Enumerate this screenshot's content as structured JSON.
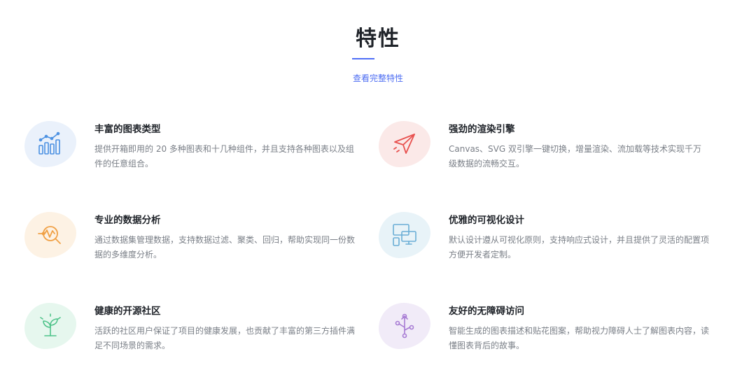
{
  "header": {
    "title": "特性",
    "link": "查看完整特性"
  },
  "features": [
    {
      "title": "丰富的图表类型",
      "desc": "提供开箱即用的 20 多种图表和十几种组件，并且支持各种图表以及组件的任意组合。",
      "icon": "bar-chart-icon",
      "color": "#4a90e2",
      "bg": "#eaf1fb"
    },
    {
      "title": "强劲的渲染引擎",
      "desc": "Canvas、SVG 双引擎一键切换，增量渲染、流加载等技术实现千万级数据的流畅交互。",
      "icon": "paper-plane-icon",
      "color": "#e8514f",
      "bg": "#fbe9e8"
    },
    {
      "title": "专业的数据分析",
      "desc": "通过数据集管理数据，支持数据过滤、聚类、回归，帮助实现同一份数据的多维度分析。",
      "icon": "analysis-magnifier-icon",
      "color": "#f0a045",
      "bg": "#fdf2e4"
    },
    {
      "title": "优雅的可视化设计",
      "desc": "默认设计遵从可视化原则，支持响应式设计，并且提供了灵活的配置项方便开发者定制。",
      "icon": "responsive-devices-icon",
      "color": "#6aaed6",
      "bg": "#e8f3f8"
    },
    {
      "title": "健康的开源社区",
      "desc": "活跃的社区用户保证了项目的健康发展，也贡献了丰富的第三方插件满足不同场景的需求。",
      "icon": "sprout-icon",
      "color": "#4fc38a",
      "bg": "#e6f7ee"
    },
    {
      "title": "友好的无障碍访问",
      "desc": "智能生成的图表描述和贴花图案，帮助视力障碍人士了解图表内容，读懂图表背后的故事。",
      "icon": "branch-nodes-icon",
      "color": "#a77bd4",
      "bg": "#f1ebf8"
    }
  ]
}
